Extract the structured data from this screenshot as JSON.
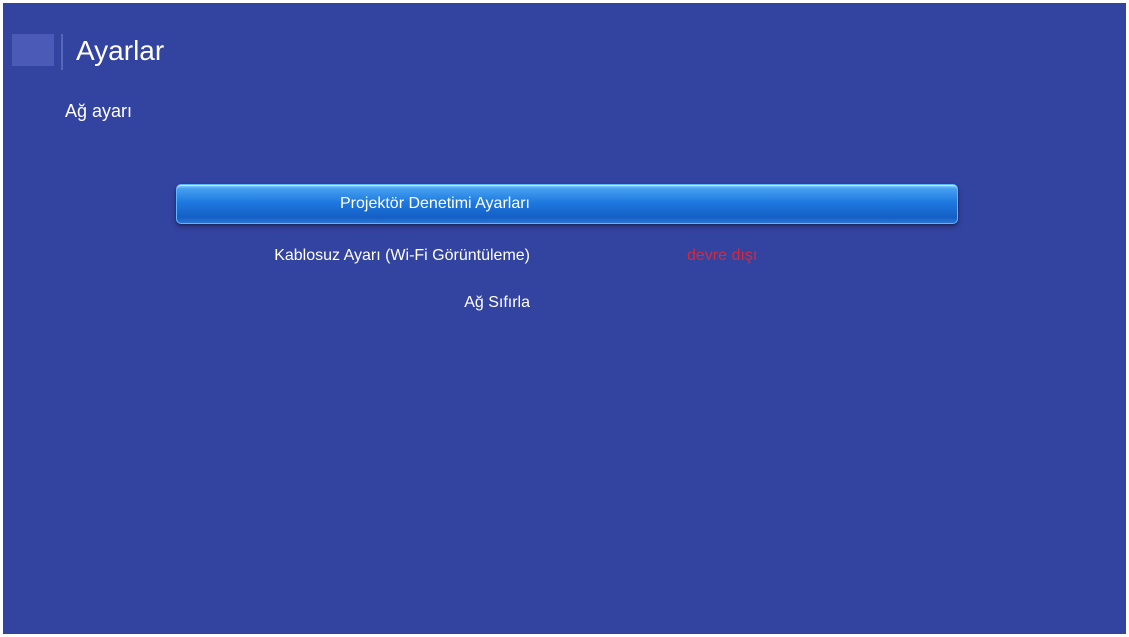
{
  "header": {
    "title": "Ayarlar",
    "subtitle": "Ağ ayarı"
  },
  "menu": {
    "items": [
      {
        "label": "Projektör Denetimi Ayarları",
        "value": "",
        "selected": true
      },
      {
        "label": "Kablosuz Ayarı (Wi-Fi Görüntüleme)",
        "value": "devre dışı",
        "selected": false
      },
      {
        "label": "Ağ Sıfırla",
        "value": "",
        "selected": false
      }
    ]
  },
  "colors": {
    "background": "#3343a0",
    "highlight": "#1e79e0",
    "value_disabled": "#d9283b",
    "text": "#ffffff"
  }
}
